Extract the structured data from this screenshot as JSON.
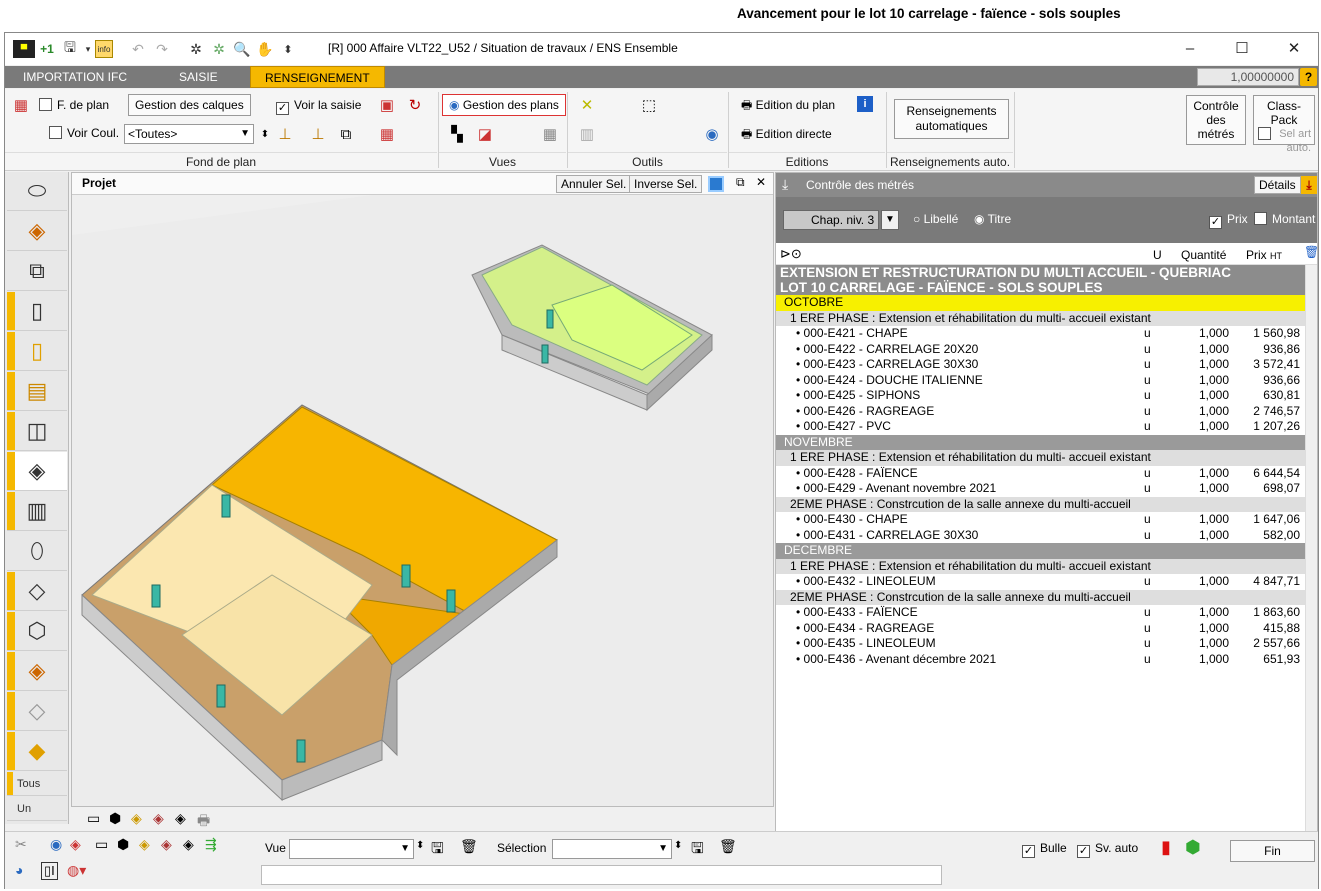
{
  "caption": "Avancement pour le lot 10 carrelage - faïence - sols souples",
  "window": {
    "title": "[R] 000   Affaire VLT22_U52 / Situation de travaux / ENS Ensemble"
  },
  "tabs": [
    {
      "label": "IMPORTATION IFC"
    },
    {
      "label": "SAISIE"
    },
    {
      "label": "RENSEIGNEMENT"
    }
  ],
  "scale_value": "1,00000000",
  "ribbon": {
    "fond_de_plan": {
      "f_de_plan": "F. de plan",
      "gestion_calques": "Gestion des calques",
      "voir_saisie": "Voir la saisie",
      "voir_coul": "Voir Coul.",
      "toutes": "<Toutes>",
      "group_label": "Fond de plan"
    },
    "vues": {
      "gestion_plans": "Gestion des plans",
      "group_label": "Vues"
    },
    "outils": {
      "group_label": "Outils"
    },
    "editions": {
      "edition_plan": "Edition du plan",
      "edition_directe": "Edition directe",
      "group_label": "Editions"
    },
    "renseignements": {
      "button": "Renseignements automatiques",
      "group_label": "Renseignements auto."
    },
    "controle": "Contrôle des métrés",
    "class_pack": "Class-Pack",
    "sel_art": "Sel art auto."
  },
  "viewport": {
    "title": "Projet",
    "annuler_sel": "Annuler Sel.",
    "inverse_sel": "Inverse Sel."
  },
  "panel": {
    "title": "Contrôle des métrés",
    "details": "Détails",
    "chap_niv": "Chap. niv. 3",
    "libelle": "Libellé",
    "titre": "Titre",
    "prix": "Prix",
    "montant": "Montant",
    "col_u": "U",
    "col_quantite": "Quantité",
    "col_prix": "Prix",
    "col_prix_suffix": "HT",
    "rows": [
      {
        "kind": "header",
        "label": "EXTENSION ET RESTRUCTURATION DU MULTI ACCUEIL - QUEBRIAC"
      },
      {
        "kind": "header",
        "label": "LOT 10 CARRELAGE - FAÏENCE - SOLS SOUPLES"
      },
      {
        "kind": "month hl",
        "label": "OCTOBRE"
      },
      {
        "kind": "phase",
        "label": "1 ERE PHASE : Extension et réhabilitation du multi- accueil existant"
      },
      {
        "kind": "item",
        "label": "• 000-E421 - CHAPE",
        "u": "u",
        "q": "1,000",
        "p": "1 560,98"
      },
      {
        "kind": "item",
        "label": "• 000-E422 - CARRELAGE 20X20",
        "u": "u",
        "q": "1,000",
        "p": "936,86"
      },
      {
        "kind": "item",
        "label": "• 000-E423 - CARRELAGE 30X30",
        "u": "u",
        "q": "1,000",
        "p": "3 572,41"
      },
      {
        "kind": "item",
        "label": "• 000-E424 - DOUCHE ITALIENNE",
        "u": "u",
        "q": "1,000",
        "p": "936,66"
      },
      {
        "kind": "item",
        "label": "• 000-E425 - SIPHONS",
        "u": "u",
        "q": "1,000",
        "p": "630,81"
      },
      {
        "kind": "item",
        "label": "• 000-E426 - RAGREAGE",
        "u": "u",
        "q": "1,000",
        "p": "2 746,57"
      },
      {
        "kind": "item",
        "label": "• 000-E427 - PVC",
        "u": "u",
        "q": "1,000",
        "p": "1 207,26"
      },
      {
        "kind": "month",
        "label": "NOVEMBRE"
      },
      {
        "kind": "phase",
        "label": "1 ERE PHASE : Extension et réhabilitation du multi- accueil existant"
      },
      {
        "kind": "item",
        "label": "• 000-E428 - FAÏENCE",
        "u": "u",
        "q": "1,000",
        "p": "6 644,54"
      },
      {
        "kind": "item",
        "label": "• 000-E429 - Avenant novembre 2021",
        "u": "u",
        "q": "1,000",
        "p": "698,07"
      },
      {
        "kind": "phase",
        "label": "2EME PHASE : Constrcution de la salle annexe du multi-accueil"
      },
      {
        "kind": "item",
        "label": "• 000-E430 - CHAPE",
        "u": "u",
        "q": "1,000",
        "p": "1 647,06"
      },
      {
        "kind": "item",
        "label": "• 000-E431 - CARRELAGE 30X30",
        "u": "u",
        "q": "1,000",
        "p": "582,00"
      },
      {
        "kind": "month",
        "label": "DECEMBRE"
      },
      {
        "kind": "phase",
        "label": "1 ERE PHASE : Extension et réhabilitation du multi- accueil existant"
      },
      {
        "kind": "item",
        "label": "• 000-E432 - LINEOLEUM",
        "u": "u",
        "q": "1,000",
        "p": "4 847,71"
      },
      {
        "kind": "phase",
        "label": "2EME PHASE : Constrcution de la salle annexe du multi-accueil"
      },
      {
        "kind": "item",
        "label": "• 000-E433 - FAÏENCE",
        "u": "u",
        "q": "1,000",
        "p": "1 863,60"
      },
      {
        "kind": "item",
        "label": "• 000-E434 - RAGREAGE",
        "u": "u",
        "q": "1,000",
        "p": "415,88"
      },
      {
        "kind": "item",
        "label": "• 000-E435 - LINEOLEUM",
        "u": "u",
        "q": "1,000",
        "p": "2 557,66"
      },
      {
        "kind": "item",
        "label": "• 000-E436 - Avenant décembre 2021",
        "u": "u",
        "q": "1,000",
        "p": "651,93"
      }
    ]
  },
  "left_tools": {
    "tous": "Tous",
    "un": "Un"
  },
  "status": {
    "vue": "Vue",
    "selection": "Sélection",
    "bulle": "Bulle",
    "sv_auto": "Sv. auto",
    "fin": "Fin"
  },
  "colors": {
    "accent": "#f5b800",
    "highlight_row": "#f7f000",
    "tab_bar": "#7a7a7a"
  }
}
